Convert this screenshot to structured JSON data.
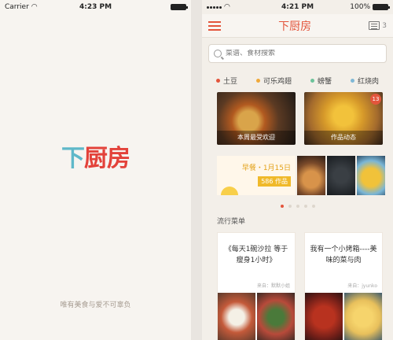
{
  "left_screen": {
    "status": {
      "carrier": "Carrier",
      "time": "4:23 PM"
    },
    "logo": [
      "下",
      "厨",
      "房"
    ],
    "slogan": "唯有美食与爱不可辜负"
  },
  "right_screen": {
    "status": {
      "time": "4:21 PM",
      "battery": "100%",
      "battery_level": 1.0
    },
    "navbar": {
      "title": "下厨房",
      "list_count": "3"
    },
    "search": {
      "placeholder": "菜谱、食材搜索"
    },
    "tags": [
      {
        "label": "土豆",
        "color": "#e3553c"
      },
      {
        "label": "可乐鸡翅",
        "color": "#f0a93a"
      },
      {
        "label": "螃蟹",
        "color": "#6cc39a"
      },
      {
        "label": "红烧肉",
        "color": "#7fb8d6"
      }
    ],
    "cards": [
      {
        "caption": "本周最受欢迎"
      },
      {
        "caption": "作品动态",
        "badge": "13"
      }
    ],
    "breakfast": {
      "title": "早餐・1月15日",
      "count": "586 作品"
    },
    "carousel": {
      "pages": 5,
      "active": 1
    },
    "section_title": "流行菜单",
    "recipes": [
      {
        "title": "《每天1碗沙拉 等于瘦身1小时》",
        "author": "来自：默默小姐"
      },
      {
        "title": "我有一个小烤箱----美味的菜与肉",
        "author": "来自：jyunko"
      }
    ]
  }
}
